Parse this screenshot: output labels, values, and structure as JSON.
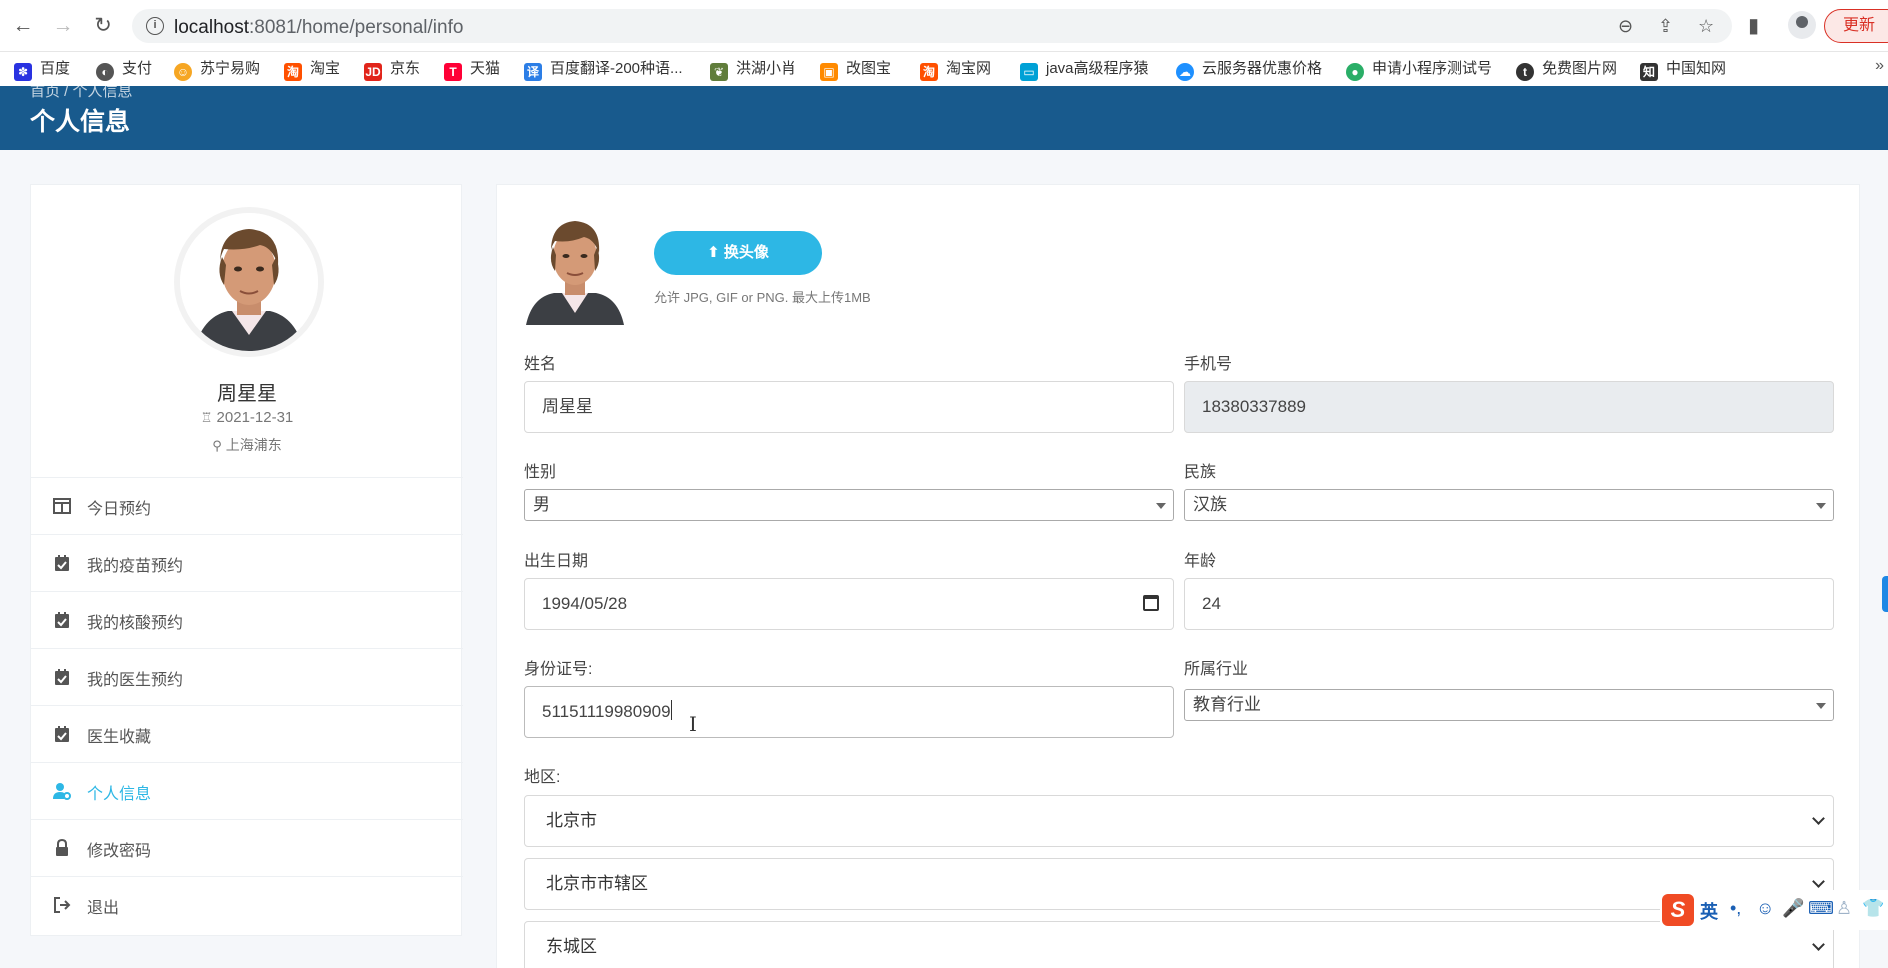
{
  "browser": {
    "url_host": "localhost",
    "url_rest": ":8081/home/personal/info",
    "update_label": "更新",
    "bookmarks": [
      {
        "label": "百度",
        "icon": "paw-icon",
        "color": "#2932e1"
      },
      {
        "label": "支付",
        "icon": "globe-icon",
        "color": "#555555"
      },
      {
        "label": "苏宁易购",
        "icon": "lion-icon",
        "color": "#f6a623"
      },
      {
        "label": "淘宝",
        "icon": "taobao-icon",
        "color": "#ff5000"
      },
      {
        "label": "京东",
        "icon": "jd-icon",
        "color": "#e1251b"
      },
      {
        "label": "天猫",
        "icon": "tmall-icon",
        "color": "#ff0036"
      },
      {
        "label": "百度翻译-200种语...",
        "icon": "translate-icon",
        "color": "#2c7ee6"
      },
      {
        "label": "洪湖小肖",
        "icon": "leaf-icon",
        "color": "#607d3b"
      },
      {
        "label": "改图宝",
        "icon": "photo-icon",
        "color": "#ff8a00"
      },
      {
        "label": "淘宝网",
        "icon": "taobao-icon",
        "color": "#ff5000"
      },
      {
        "label": "java高级程序猿",
        "icon": "bilibili-icon",
        "color": "#00a1d6"
      },
      {
        "label": "云服务器优惠价格",
        "icon": "cloud-icon",
        "color": "#1e90ff"
      },
      {
        "label": "申请小程序测试号",
        "icon": "wechat-icon",
        "color": "#2aae67"
      },
      {
        "label": "免费图片网",
        "icon": "t-icon",
        "color": "#333333"
      },
      {
        "label": "中国知网",
        "icon": "cnki-icon",
        "color": "#333333"
      }
    ]
  },
  "header": {
    "breadcrumb": "首页 / 个人信息",
    "title": "个人信息"
  },
  "profile": {
    "name": "周星星",
    "birthday": "2021-12-31",
    "location": "上海浦东"
  },
  "menu": [
    {
      "label": "今日预约",
      "icon": "table-icon"
    },
    {
      "label": "我的疫苗预约",
      "icon": "calendar-check-icon"
    },
    {
      "label": "我的核酸预约",
      "icon": "calendar-check-icon"
    },
    {
      "label": "我的医生预约",
      "icon": "calendar-check-icon"
    },
    {
      "label": "医生收藏",
      "icon": "calendar-check-icon"
    },
    {
      "label": "个人信息",
      "icon": "user-cog-icon",
      "active": true
    },
    {
      "label": "修改密码",
      "icon": "lock-icon"
    },
    {
      "label": "退出",
      "icon": "sign-out-icon"
    }
  ],
  "form": {
    "upload_label": "换头像",
    "upload_hint": "允许 JPG, GIF or PNG. 最大上传1MB",
    "name_label": "姓名",
    "name_value": "周星星",
    "phone_label": "手机号",
    "phone_value": "18380337889",
    "gender_label": "性别",
    "gender_value": "男",
    "ethnicity_label": "民族",
    "ethnicity_value": "汉族",
    "birth_label": "出生日期",
    "birth_value": "1994/05/28",
    "age_label": "年龄",
    "age_value": "24",
    "id_label": "身份证号:",
    "id_value": "51151119980909",
    "industry_label": "所属行业",
    "industry_value": "教育行业",
    "region_label": "地区:",
    "province_value": "北京市",
    "city_value": "北京市市辖区",
    "district_value": "东城区"
  },
  "ime": {
    "mode": "英"
  },
  "colors": {
    "brand": "#185a8d",
    "accent": "#2db7e5"
  }
}
